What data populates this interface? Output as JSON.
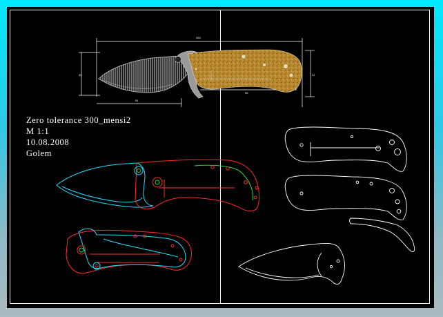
{
  "title_block": {
    "name": "Zero tolerance 300_mensi2",
    "scale": "M 1:1",
    "date": "10.08.2008",
    "author": "Golem"
  },
  "dimensions": {
    "overall": "264",
    "handle_height": "40",
    "blade_length": "91",
    "handle_length": "95",
    "blade_height": "41"
  },
  "colors": {
    "background": "#000000",
    "line_white": "#ffffff",
    "line_red": "#ff2a2a",
    "line_cyan": "#20e0ff",
    "line_green": "#22dd33",
    "handle_fill": "#b8892f"
  }
}
